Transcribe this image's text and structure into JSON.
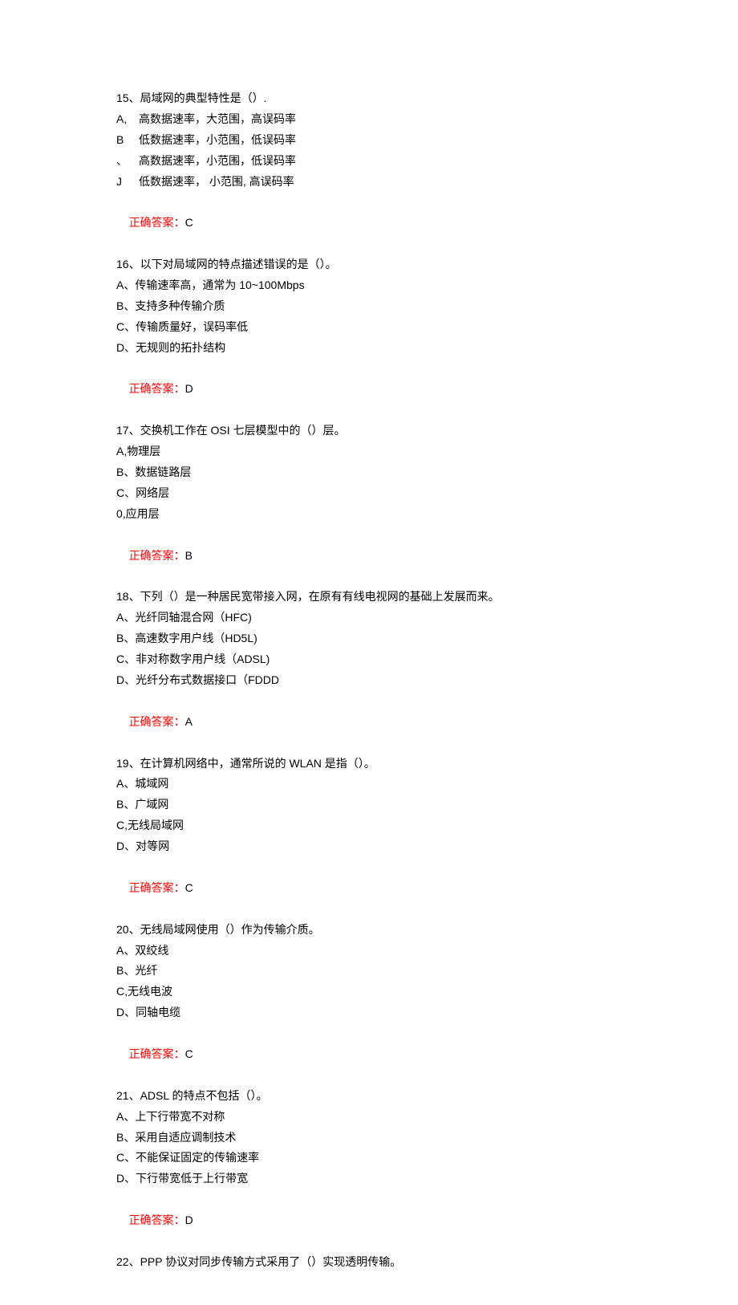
{
  "answer_label": "正确答案：",
  "questions": [
    {
      "prompt": "15、局域网的典型特性是（）.",
      "style": "spaced",
      "options": [
        {
          "key": "A,",
          "text": "高数据速率，大范围，高误码率"
        },
        {
          "key": "B",
          "text": "低数据速率，小范围，低误码率"
        },
        {
          "key": "、",
          "text": "高数据速率，小范围，低误码率"
        },
        {
          "key": "J",
          "text": "低数据速率，  小范围,   高误码率"
        }
      ],
      "answer": "C"
    },
    {
      "prompt": "16、以下对局域网的特点描述错误的是（）。",
      "options": [
        "A、传输速率高，通常为 10~100Mbps",
        "B、支持多种传输介质",
        "C、传输质量好，误码率低",
        "D、无规则的拓扑结构"
      ],
      "answer": "D"
    },
    {
      "prompt": "17、交换机工作在 OSI 七层模型中的（）层。",
      "options": [
        "A,物理层",
        "B、数据链路层",
        "C、网络层",
        "0,应用层"
      ],
      "answer": "B"
    },
    {
      "prompt": "18、下列（）是一种居民宽带接入网，在原有有线电视网的基础上发展而来。",
      "options": [
        "A、光纤同轴混合网（HFC)",
        "B、高速数字用户线（HD5L)",
        "C、非对称数字用户线（ADSL)",
        "D、光纤分布式数据接口（FDDD"
      ],
      "answer": "A"
    },
    {
      "prompt": "19、在计算机网络中，通常所说的 WLAN 是指（）。",
      "options": [
        "A、城域网",
        "B、广域网",
        "C,无线局域网",
        "D、对等网"
      ],
      "answer": "C"
    },
    {
      "prompt": "20、无线局域网使用（）作为传输介质。",
      "options": [
        "A、双绞线",
        "B、光纤",
        "C,无线电波",
        "D、同轴电缆"
      ],
      "answer": "C"
    },
    {
      "prompt": "21、ADSL 的特点不包括（）。",
      "options": [
        "A、上下行带宽不对称",
        "B、采用自适应调制技术",
        "C、不能保证固定的传输速率",
        "D、下行带宽低于上行带宽"
      ],
      "answer": "D"
    },
    {
      "prompt": "22、PPP 协议对同步传输方式采用了（）实现透明传输。"
    }
  ]
}
